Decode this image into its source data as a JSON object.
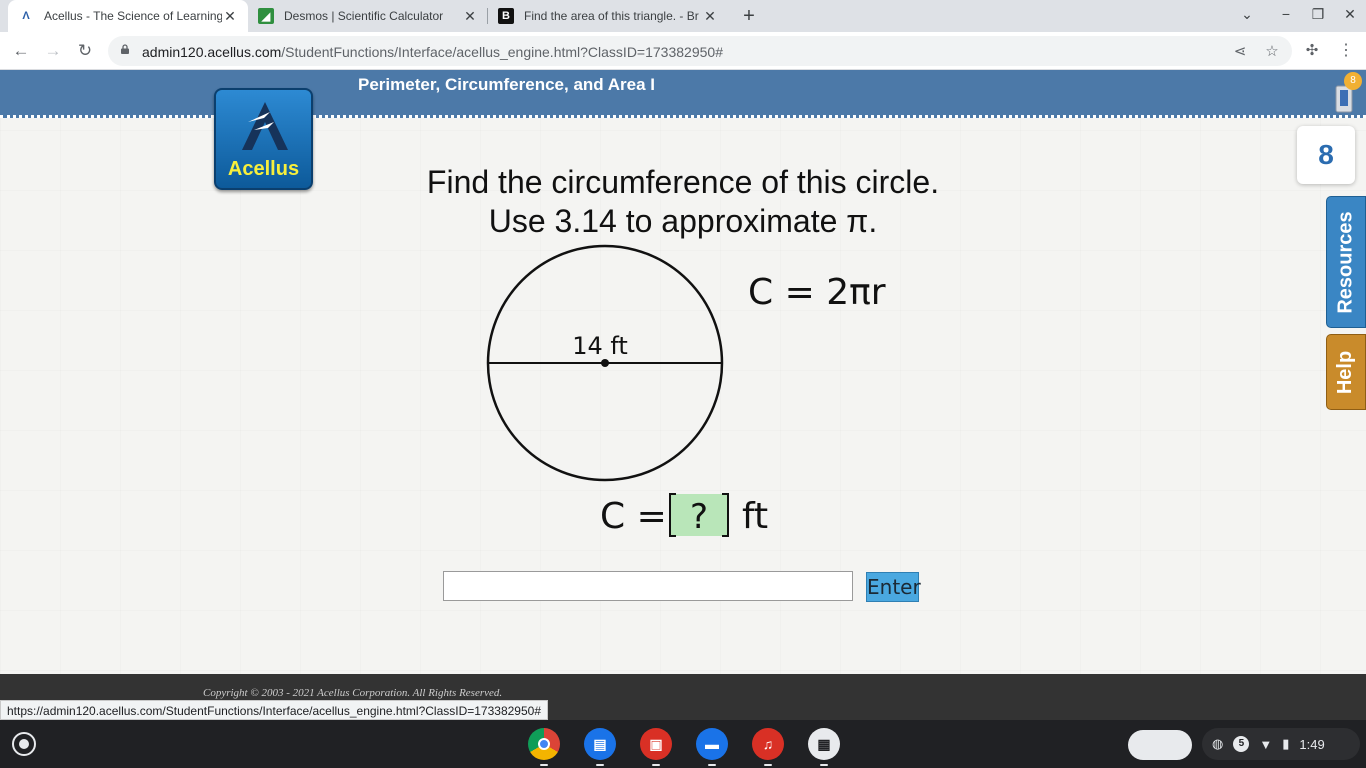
{
  "browser": {
    "tabs": [
      {
        "title": "Acellus - The Science of Learning",
        "active": true
      },
      {
        "title": "Desmos | Scientific Calculator",
        "active": false
      },
      {
        "title": "Find the area of this triangle. - Br",
        "active": false
      }
    ],
    "url_host": "admin120.acellus.com",
    "url_path": "/StudentFunctions/Interface/acellus_engine.html?ClassID=173382950#",
    "status_url": "https://admin120.acellus.com/StudentFunctions/Interface/acellus_engine.html?ClassID=173382950#"
  },
  "lesson": {
    "title": "Perimeter, Circumference, and Area I",
    "brand": "Acellus",
    "badge_count": "8",
    "points": "8",
    "resources_label": "Resources",
    "help_label": "Help"
  },
  "question": {
    "line1": "Find the circumference of this circle.",
    "line2": "Use 3.14 to approximate π.",
    "diameter_label": "14 ft",
    "formula": "C = 2πr",
    "answer_lhs": "C = ",
    "answer_blank": "?",
    "answer_unit": "ft"
  },
  "answer": {
    "value": "",
    "enter_label": "Enter"
  },
  "footer": {
    "copyright": "Copyright © 2003 - 2021 Acellus Corporation.  All Rights Reserved."
  },
  "shelf": {
    "notifications": "5",
    "time": "1:49"
  },
  "colors": {
    "header": "#4c79a8",
    "enter_button": "#4aa8e0",
    "blank_fill": "#b9e6b9",
    "resources_tab": "#3a86c4",
    "help_tab": "#c98b2b"
  }
}
